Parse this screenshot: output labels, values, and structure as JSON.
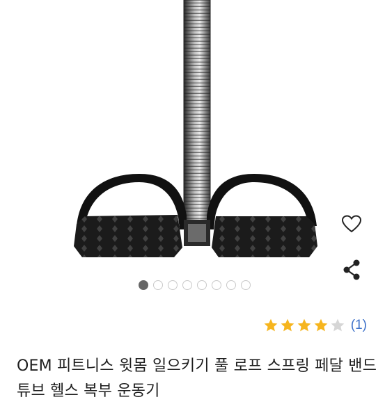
{
  "product": {
    "image_alt": "spring sit-up pull rope exerciser",
    "title": "OEM 피트니스 윗몸 일으키기 풀 로프 스프링 페달 밴드 튜브 헬스 복부 운동기",
    "rating": {
      "stars": 4,
      "max_stars": 5,
      "count_label": "(1)"
    }
  },
  "gallery": {
    "total": 8,
    "active_index": 0
  },
  "icons": {
    "favorite": "heart-outline-icon",
    "share": "share-icon"
  },
  "colors": {
    "star_filled": "#f6b51e",
    "star_empty": "#d6d6d6",
    "link_blue": "#3e71c9",
    "active_dot": "#666666"
  }
}
